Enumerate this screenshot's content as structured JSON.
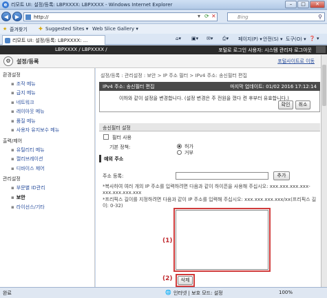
{
  "window": {
    "title": "리모트 UI: 설정/등록: LBPXXXX: LBPXXXX - Windows Internet Explorer",
    "address": "http://",
    "search_placeholder": "Bing"
  },
  "favorites_bar": {
    "favorites": "즐겨찾기",
    "suggested": "Suggested Sites ▾",
    "webslice": "Web Slice Gallery ▾"
  },
  "tab": {
    "title": "리모트 UI: 설정/등록: LBPXXXX: ..."
  },
  "ie_toolbar": {
    "page": "페이지(P) ▾",
    "safety": "안전(S) ▾",
    "tools": "도구(O) ▾",
    "help": "❓ ▾"
  },
  "device_bar": {
    "device_name": "LBPXXXX / LBPXXXX /",
    "login_info": "포털로 로그인 사용자: 시스템 관리자 로그아웃"
  },
  "header": {
    "title": "설정/등록",
    "portal_link": "포털사이트로 이동"
  },
  "sidebar": {
    "sections": [
      {
        "label": "환경설정",
        "items": [
          "조작 메뉴",
          "급지 메뉴",
          "네트워크",
          "레이아웃 메뉴",
          "품질 메뉴",
          "사용자 유지보수 메뉴"
        ]
      },
      {
        "label": "출력/제어",
        "items": [
          "유틸리티 메뉴",
          "캘리브레이션",
          "디바이스 제어"
        ]
      },
      {
        "label": "관리설정",
        "items": [
          "부문별 ID관리",
          "보안",
          "라이선스/기타"
        ]
      }
    ],
    "active_item": "보안"
  },
  "main": {
    "breadcrumb": "설정/등록 : 관리설정 : 보안 > IP 주소 필터 > IPv4 주소: 송신필터 편집",
    "edit_title": "IPv4 주소: 송신필터 편집",
    "last_update": "마지막 업데이트: 01/02 2016 17:12:14",
    "message": "이하와 같이 설정을 변경합니다. (설정 변경은 주 전원을 껐다 켠 후부터 유효합니다.)",
    "ok_button": "확인",
    "cancel_button": "취소",
    "filter_section_title": "송신필터 설정",
    "use_filter_label": "필터 사용",
    "default_policy_label": "기본 정책:",
    "policy_options": [
      "허가",
      "거부"
    ],
    "policy_selected": "허가",
    "exception_title": "예외 주소",
    "address_register_label": "주소 등록:",
    "add_button": "추가",
    "note1": "*복사하여 여러 개의 IP 주소를 입력하려면 다음과 같이 하이픈을 사용해 주십시오: xxx.xxx.xxx.xxx-xxx.xxx.xxx.xxx",
    "note2": "*프리픽스 길이를 지정하려면 다음과 같이 IP 주소를 입력해 주십시오: xxx.xxx.xxx.xxx/xx(프리픽스 길이: 0-32)",
    "delete_button": "삭제",
    "callout1": "(1)",
    "callout2": "(2)"
  },
  "status_bar": {
    "left": "완료",
    "zone": "인터넷 | 보호 모드: 설정",
    "zoom": "100%"
  }
}
